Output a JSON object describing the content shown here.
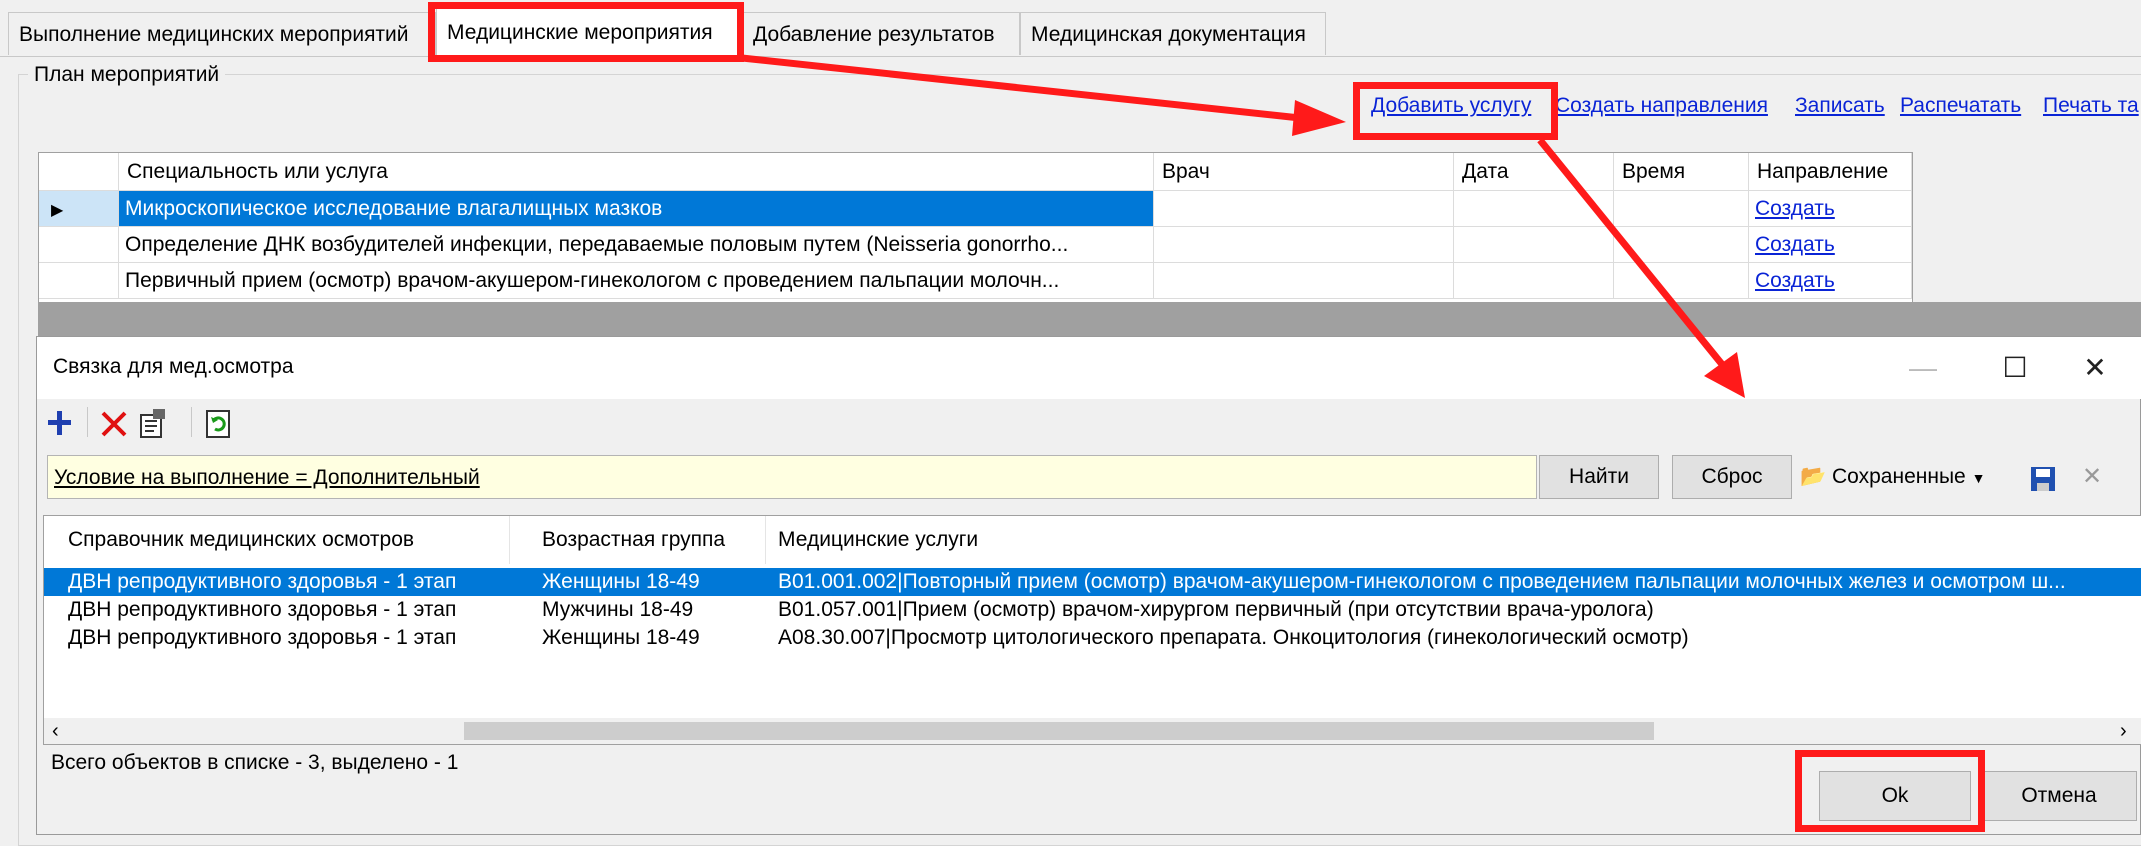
{
  "tabs": [
    {
      "label": "Выполнение медицинских мероприятий"
    },
    {
      "label": "Медицинские мероприятия"
    },
    {
      "label": "Добавление результатов"
    },
    {
      "label": "Медицинская документация"
    }
  ],
  "plan": {
    "group_title": "План мероприятий",
    "links": [
      "Добавить услугу",
      "Создать направления",
      "Записать",
      "Распечатать",
      "Печать та"
    ]
  },
  "top_grid": {
    "columns": [
      "Специальность или услуга",
      "Врач",
      "Дата",
      "Время",
      "Направление"
    ],
    "rows": [
      {
        "service": "Микроскопическое исследование влагалищных мазков",
        "doctor": "",
        "date": "",
        "time": "",
        "direction": "Создать"
      },
      {
        "service": "Определение ДНК возбудителей инфекции, передаваемые половым путем (Neisseria gonorrho...",
        "doctor": "",
        "date": "",
        "time": "",
        "direction": "Создать"
      },
      {
        "service": "Первичный прием (осмотр) врачом-акушером-гинекологом с проведением пальпации молочн...",
        "doctor": "",
        "date": "",
        "time": "",
        "direction": "Создать"
      }
    ]
  },
  "dialog": {
    "title": "Связка для мед.осмотра",
    "window_buttons": {
      "minimize": "—",
      "maximize": "☐",
      "close": "✕"
    },
    "filter_text": "Условие на выполнение = Дополнительный",
    "find_label": "Найти",
    "reset_label": "Сброс",
    "saved_label": "Сохраненные",
    "list_columns": [
      "Справочник медицинских осмотров",
      "Возрастная группа",
      "Медицинские услуги"
    ],
    "list_rows": [
      {
        "ref": "ДВН репродуктивного здоровья - 1 этап",
        "age": "Женщины 18-49",
        "service": "B01.001.002|Повторный прием (осмотр) врачом-акушером-гинекологом с проведением пальпации молочных желез и осмотром ш..."
      },
      {
        "ref": "ДВН репродуктивного здоровья - 1 этап",
        "age": "Мужчины 18-49",
        "service": "B01.057.001|Прием (осмотр) врачом-хирургом первичный (при отсутствии врача-уролога)"
      },
      {
        "ref": "ДВН репродуктивного здоровья - 1 этап",
        "age": "Женщины 18-49",
        "service": "A08.30.007|Просмотр цитологического препарата. Онкоцитология (гинекологический осмотр)"
      }
    ],
    "status_text": "Всего объектов в списке - 3, выделено - 1",
    "ok_label": "Ok",
    "cancel_label": "Отмена"
  },
  "colors": {
    "annotation_red": "#ff1a1a",
    "selection_blue": "#0078d7",
    "link_blue": "#0a24d6",
    "filter_yellow": "#ffffe1"
  }
}
